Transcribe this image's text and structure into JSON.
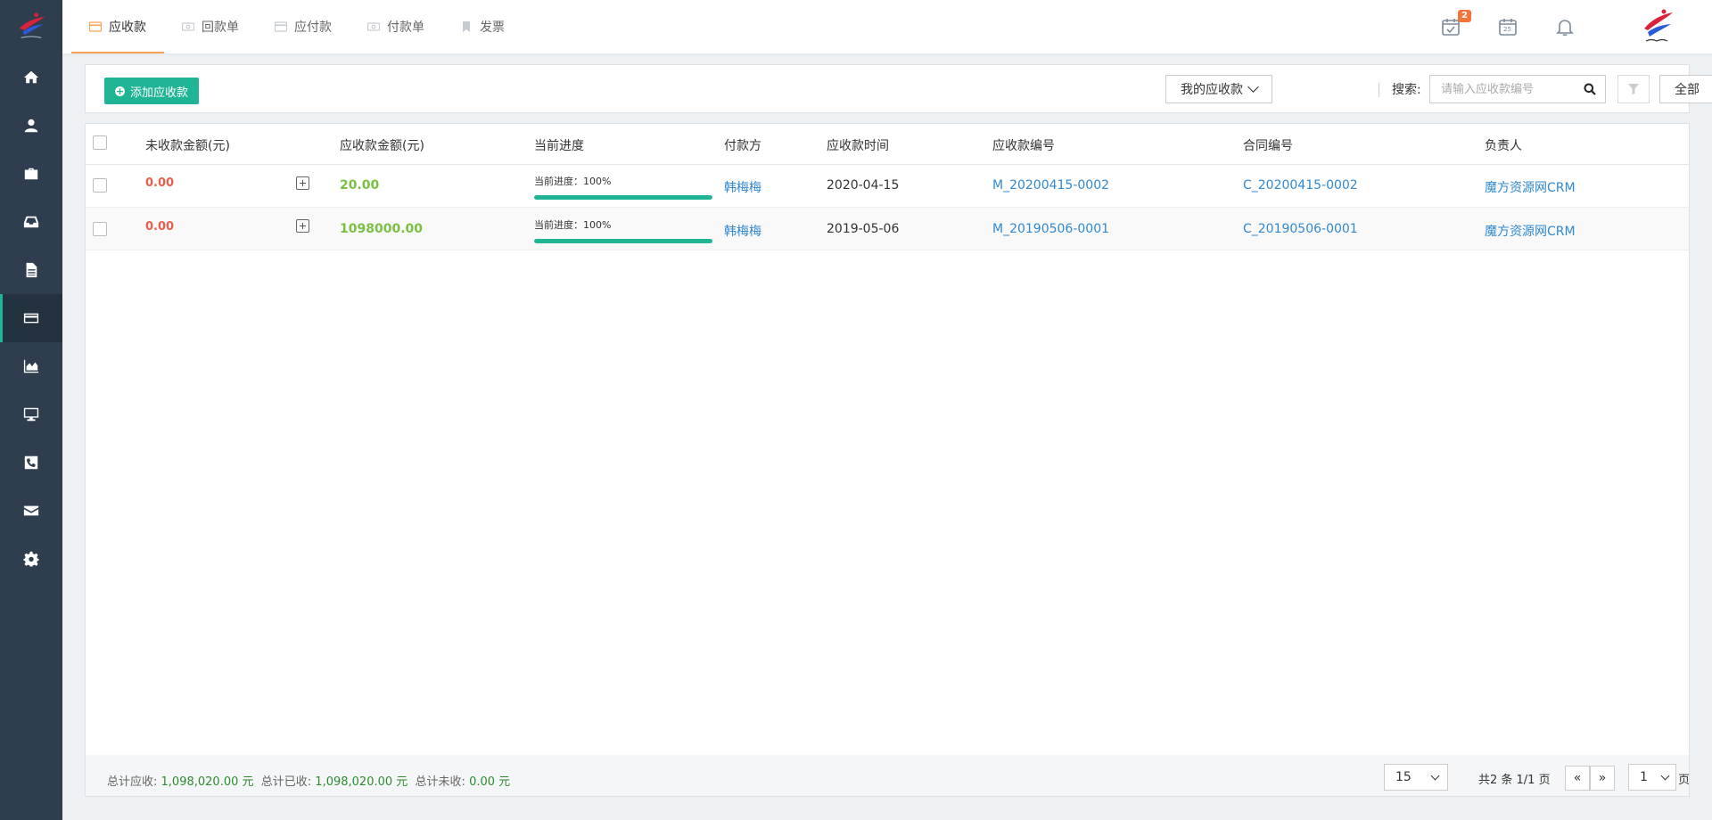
{
  "sidebar": {
    "items": [
      {
        "icon": "home-icon",
        "active": false
      },
      {
        "icon": "user-icon",
        "active": false
      },
      {
        "icon": "briefcase-icon",
        "active": false
      },
      {
        "icon": "inbox-icon",
        "active": false
      },
      {
        "icon": "document-icon",
        "active": false
      },
      {
        "icon": "credit-card-icon",
        "active": true
      },
      {
        "icon": "area-chart-icon",
        "active": false
      },
      {
        "icon": "monitor-icon",
        "active": false
      },
      {
        "icon": "phone-icon",
        "active": false
      },
      {
        "icon": "envelope-icon",
        "active": false
      },
      {
        "icon": "gear-icon",
        "active": false
      }
    ]
  },
  "tabs": [
    {
      "label": "应收款",
      "icon": "credit-card-icon",
      "active": true
    },
    {
      "label": "回款单",
      "icon": "money-icon",
      "active": false
    },
    {
      "label": "应付款",
      "icon": "credit-card-icon",
      "active": false
    },
    {
      "label": "付款单",
      "icon": "money-icon",
      "active": false
    },
    {
      "label": "发票",
      "icon": "bookmark-icon",
      "active": false
    }
  ],
  "header": {
    "task_badge": "2",
    "calendar_day": "25"
  },
  "toolbar": {
    "add_label": "添加应收款",
    "scope_select": "我的应收款",
    "search_label": "搜索:",
    "search_placeholder": "请输入应收款编号",
    "status_select": "全部"
  },
  "table": {
    "headers": {
      "unreceived": "未收款金额(元)",
      "amount": "应收款金额(元)",
      "progress": "当前进度",
      "payer": "付款方",
      "date": "应收款时间",
      "number": "应收款编号",
      "contract": "合同编号",
      "owner": "负责人"
    },
    "rows": [
      {
        "unreceived": "0.00",
        "amount": "20.00",
        "progress_label": "当前进度：100%",
        "progress_value": 100,
        "payer": "韩梅梅",
        "date": "2020-04-15",
        "number": "M_20200415-0002",
        "contract": "C_20200415-0002",
        "owner": "魔方资源网CRM"
      },
      {
        "unreceived": "0.00",
        "amount": "1098000.00",
        "progress_label": "当前进度：100%",
        "progress_value": 100,
        "payer": "韩梅梅",
        "date": "2019-05-06",
        "number": "M_20190506-0001",
        "contract": "C_20190506-0001",
        "owner": "魔方资源网CRM"
      }
    ]
  },
  "footer": {
    "total_due_label": "总计应收:",
    "total_due": "1,098,020.00 元",
    "total_received_label": "总计已收:",
    "total_received": "1,098,020.00 元",
    "total_unreceived_label": "总计未收:",
    "total_unreceived": "0.00 元",
    "page_size": "15",
    "page_info": "共2 条 1/1 页",
    "prev": "«",
    "next": "»",
    "current_page": "1",
    "page_unit": "页"
  },
  "colors": {
    "accent": "#1fb494",
    "sidebar": "#2f3e4f",
    "tab_active": "#f3a356",
    "negative": "#e95f4c",
    "positive": "#7ac143",
    "link": "#3189d0"
  }
}
